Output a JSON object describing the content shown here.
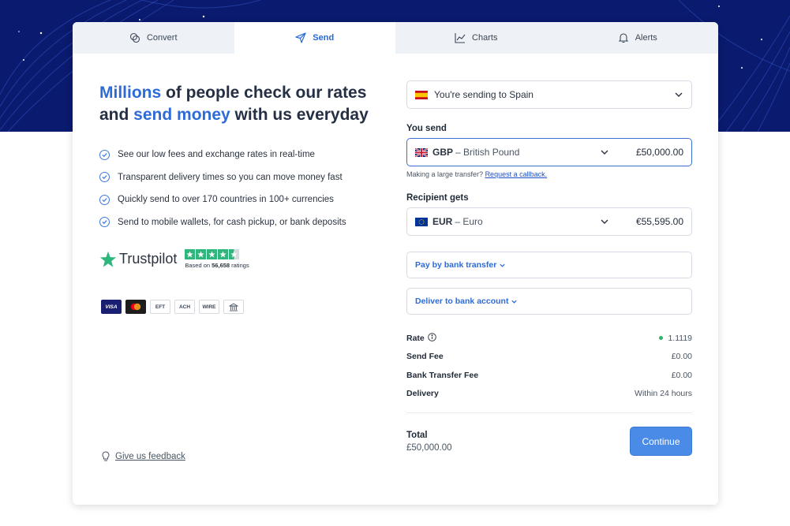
{
  "tabs": [
    {
      "label": "Convert",
      "icon": "coins-icon"
    },
    {
      "label": "Send",
      "icon": "paper-plane-icon"
    },
    {
      "label": "Charts",
      "icon": "line-chart-icon"
    },
    {
      "label": "Alerts",
      "icon": "bell-icon"
    }
  ],
  "active_tab": "Send",
  "headline": {
    "part1": "Millions",
    "part2": " of people check our rates and ",
    "part3": "send money",
    "part4": " with us everyday"
  },
  "features": [
    "See our low fees and exchange rates in real-time",
    "Transparent delivery times so you can move money fast",
    "Quickly send to over 170 countries in 100+ currencies",
    "Send to mobile wallets, for cash pickup, or bank deposits"
  ],
  "trustpilot": {
    "name": "Trustpilot",
    "based_on": "Based on ",
    "rating_count": "56,658",
    "ratings_word": " ratings",
    "stars_filled": 4.5,
    "stars_total": 5
  },
  "payment_methods": [
    "VISA",
    "mastercard",
    "EFT",
    "ACH",
    "WIRE",
    "bank"
  ],
  "feedback_link": "Give us feedback",
  "destination": {
    "prefix": "You're sending to",
    "country": "Spain"
  },
  "you_send": {
    "label": "You send",
    "currency_code": "GBP",
    "currency_name": "– British Pound",
    "amount": "£50,000.00"
  },
  "large_transfer": {
    "text": "Making a large transfer? ",
    "link": "Request a callback."
  },
  "recipient_gets": {
    "label": "Recipient gets",
    "currency_code": "EUR",
    "currency_name": "– Euro",
    "amount": "€55,595.00"
  },
  "pay_method": "Pay by bank transfer",
  "deliver_method": "Deliver to bank account",
  "summary": {
    "rate_label": "Rate",
    "rate_value": "1.1119",
    "send_fee_label": "Send Fee",
    "send_fee_value": "£0.00",
    "bank_fee_label": "Bank Transfer Fee",
    "bank_fee_value": "£0.00",
    "delivery_label": "Delivery",
    "delivery_value": "Within 24 hours"
  },
  "total": {
    "label": "Total",
    "value": "£50,000.00"
  },
  "continue_label": "Continue",
  "colors": {
    "brand_blue": "#2e6bd6",
    "hero_navy": "#0a1a6e",
    "button_blue": "#4a8be8",
    "trustpilot_green": "#2fb67c",
    "rate_dot": "#2db36c"
  }
}
